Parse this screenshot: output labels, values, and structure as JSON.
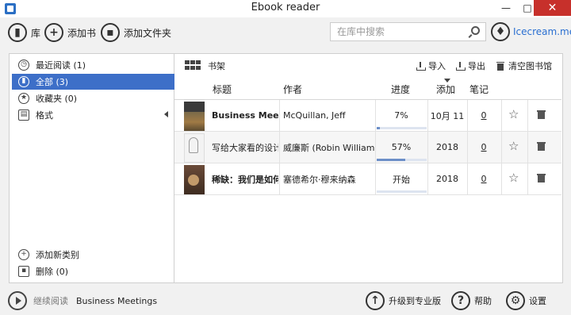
{
  "window": {
    "title": "Ebook reader",
    "minimize": "—",
    "maximize": "□",
    "close": "✕"
  },
  "toolbar": {
    "library_label": "库",
    "add_book_label": "添加书",
    "add_folder_label": "添加文件夹",
    "search_placeholder": "在库中搜索",
    "brand": "Icecream.me"
  },
  "sidebar": {
    "items": [
      {
        "label": "最近阅读 (1)",
        "icon": "clock-icon"
      },
      {
        "label": "全部 (3)",
        "icon": "book-icon"
      },
      {
        "label": "收藏夹 (0)",
        "icon": "star-icon"
      },
      {
        "label": "格式",
        "icon": "document-icon"
      }
    ],
    "add_category": "添加新类别",
    "deleted": "删除 (0)"
  },
  "main": {
    "shelf_label": "书架",
    "import_label": "导入",
    "export_label": "导出",
    "clear_label": "清空图书馆",
    "columns": {
      "title": "标题",
      "author": "作者",
      "progress": "进度",
      "added": "添加",
      "notes": "笔记"
    },
    "books": [
      {
        "title": "Business Meetings",
        "author": "McQuillan, Jeff",
        "progress_text": "7%",
        "progress_fraction": 0.07,
        "added": "10月 11",
        "notes": "0"
      },
      {
        "title": "写给大家看的设计书",
        "author": "威廉斯 (Robin Williams)",
        "progress_text": "57%",
        "progress_fraction": 0.57,
        "added": "2018",
        "notes": "0"
      },
      {
        "title": "稀缺：我们是如何陷入贫穷与忙碌的",
        "author": "塞德希尔·穆来纳森",
        "progress_text": "开始",
        "progress_fraction": 0,
        "added": "2018",
        "notes": "0"
      }
    ]
  },
  "bottombar": {
    "continue_label": "继续阅读",
    "continue_book": "Business Meetings",
    "upgrade_label": "升级到专业版",
    "help_label": "帮助",
    "settings_label": "设置"
  },
  "colors": {
    "accent": "#3d6fc8",
    "close_button": "#c7302b",
    "brand": "#2a6fd1"
  }
}
